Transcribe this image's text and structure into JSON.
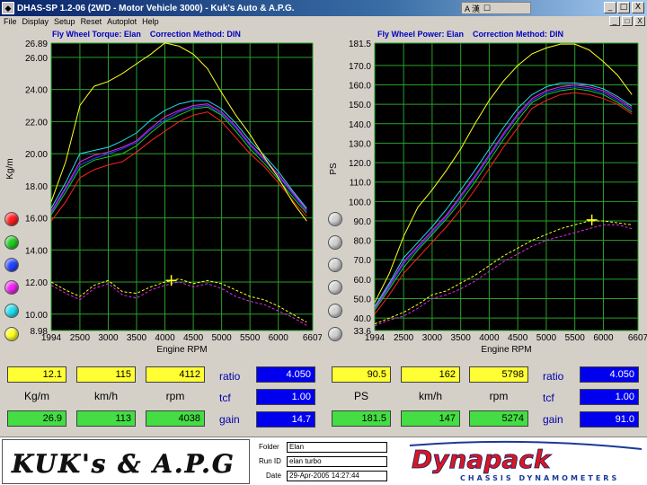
{
  "window": {
    "title": "DHAS-SP 1.2-06  (2WD - Motor Vehicle 3000) - Kuk's Auto & A.P.G.",
    "ime": "A 漢",
    "controls": [
      "_",
      "□",
      "X"
    ]
  },
  "menu": {
    "items": [
      "File",
      "Display",
      "Setup",
      "Reset",
      "Autoplot",
      "Help"
    ],
    "right_controls": [
      "_",
      "□",
      "X"
    ]
  },
  "colors": {
    "background": "#000000",
    "grid": "#2aa02a",
    "yellow_box": "#ffff33",
    "green_box": "#44dd44",
    "blue_box": "#0000ee",
    "label_blue": "#0000c0"
  },
  "run_colors": [
    "#ff2020",
    "#22cc22",
    "#2244ff",
    "#ee22ee",
    "#22ddee",
    "#ffff22"
  ],
  "chart_data": [
    {
      "type": "line",
      "title": "Fly Wheel Torque: Elan",
      "correction": "Correction Method: DIN",
      "xlabel": "Engine RPM",
      "ylabel": "Kg/m",
      "xlim": [
        1994,
        6607
      ],
      "ylim": [
        8.98,
        26.89
      ],
      "xticks": [
        "1994",
        "2500",
        "3000",
        "3500",
        "4000",
        "4500",
        "5000",
        "5500",
        "6000",
        "6607"
      ],
      "yticks": [
        "26.89",
        "26.00",
        "24.00",
        "22.00",
        "20.00",
        "18.00",
        "16.00",
        "14.00",
        "12.00",
        "10.00",
        "8.98"
      ],
      "cursor": {
        "x": 4112,
        "y": 12.1
      },
      "x": [
        1994,
        2250,
        2500,
        2750,
        3000,
        3250,
        3500,
        3750,
        4000,
        4250,
        4500,
        4750,
        5000,
        5250,
        5500,
        5750,
        6000,
        6250,
        6500
      ],
      "series": [
        {
          "name": "Run 1",
          "color": "#ff2020",
          "values": [
            15.8,
            17.0,
            18.5,
            19.0,
            19.3,
            19.5,
            20.1,
            20.8,
            21.4,
            22.0,
            22.4,
            22.6,
            22.0,
            21.0,
            20.0,
            19.2,
            18.2,
            17.1,
            16.1
          ]
        },
        {
          "name": "Run 2",
          "color": "#22cc22",
          "values": [
            16.2,
            17.6,
            19.1,
            19.6,
            19.8,
            20.0,
            20.5,
            21.3,
            22.0,
            22.4,
            22.8,
            22.9,
            22.4,
            21.4,
            20.3,
            19.4,
            18.4,
            17.3,
            16.3
          ]
        },
        {
          "name": "Run 3",
          "color": "#2244ff",
          "values": [
            16.3,
            17.8,
            19.3,
            19.7,
            20.0,
            20.3,
            20.7,
            21.5,
            22.1,
            22.6,
            22.9,
            23.0,
            22.5,
            21.6,
            20.5,
            19.6,
            18.6,
            17.5,
            16.4
          ]
        },
        {
          "name": "Run 4",
          "color": "#ee22ee",
          "values": [
            16.4,
            17.9,
            19.5,
            19.9,
            20.1,
            20.4,
            20.8,
            21.6,
            22.3,
            22.7,
            23.0,
            23.1,
            22.6,
            21.7,
            20.6,
            19.7,
            18.7,
            17.6,
            16.5
          ]
        },
        {
          "name": "Run 5",
          "color": "#22ddee",
          "values": [
            16.6,
            18.2,
            20.0,
            20.2,
            20.4,
            20.8,
            21.3,
            22.1,
            22.7,
            23.1,
            23.3,
            23.3,
            22.8,
            21.9,
            20.8,
            19.9,
            18.9,
            17.7,
            16.6
          ]
        },
        {
          "name": "Run 6",
          "color": "#ffff22",
          "values": [
            17.0,
            19.5,
            23.0,
            24.2,
            24.5,
            25.0,
            25.6,
            26.2,
            26.9,
            26.7,
            26.2,
            25.3,
            23.8,
            22.4,
            21.2,
            19.8,
            18.5,
            17.0,
            15.8
          ]
        },
        {
          "name": "Speed 1",
          "color": "#ee22ee",
          "values": [
            11.8,
            11.3,
            10.9,
            11.6,
            11.9,
            11.2,
            11.0,
            11.5,
            11.8,
            12.0,
            11.7,
            11.9,
            11.6,
            11.1,
            10.8,
            10.6,
            10.2,
            9.8,
            9.3
          ]
        },
        {
          "name": "Speed 2",
          "color": "#ffff22",
          "values": [
            12.0,
            11.5,
            11.1,
            11.8,
            12.1,
            11.4,
            11.3,
            11.7,
            12.0,
            12.2,
            11.9,
            12.1,
            11.9,
            11.5,
            11.1,
            10.9,
            10.5,
            10.0,
            9.5
          ]
        }
      ]
    },
    {
      "type": "line",
      "title": "Fly Wheel Power: Elan",
      "correction": "Correction Method: DIN",
      "xlabel": "Engine RPM",
      "ylabel": "PS",
      "xlim": [
        1994,
        6607
      ],
      "ylim": [
        33.6,
        181.5
      ],
      "xticks": [
        "1994",
        "2500",
        "3000",
        "3500",
        "4000",
        "4500",
        "5000",
        "5500",
        "6000",
        "6607"
      ],
      "yticks": [
        "181.5",
        "170.0",
        "160.0",
        "150.0",
        "140.0",
        "130.0",
        "120.0",
        "110.0",
        "100.0",
        "90.0",
        "80.0",
        "70.0",
        "60.0",
        "50.0",
        "40.0",
        "33.6"
      ],
      "cursor": {
        "x": 5798,
        "y": 90.5
      },
      "x": [
        1994,
        2250,
        2500,
        2750,
        3000,
        3250,
        3500,
        3750,
        4000,
        4250,
        4500,
        4750,
        5000,
        5250,
        5500,
        5750,
        6000,
        6250,
        6500
      ],
      "series": [
        {
          "name": "Run 1",
          "color": "#ff2020",
          "values": [
            42,
            52,
            63,
            71,
            79,
            87,
            96,
            106,
            117,
            128,
            138,
            148,
            152,
            155,
            156,
            155,
            153,
            150,
            145
          ]
        },
        {
          "name": "Run 2",
          "color": "#22cc22",
          "values": [
            44,
            55,
            66,
            75,
            83,
            91,
            100,
            110,
            121,
            132,
            142,
            151,
            155,
            157,
            158,
            157,
            155,
            151,
            146
          ]
        },
        {
          "name": "Run 3",
          "color": "#2244ff",
          "values": [
            45,
            56,
            68,
            76,
            84,
            92,
            102,
            112,
            123,
            134,
            144,
            152,
            156,
            158,
            159,
            158,
            156,
            152,
            147
          ]
        },
        {
          "name": "Run 4",
          "color": "#ee22ee",
          "values": [
            45,
            57,
            69,
            77,
            85,
            93,
            103,
            113,
            124,
            135,
            145,
            153,
            157,
            159,
            160,
            159,
            157,
            153,
            148
          ]
        },
        {
          "name": "Run 5",
          "color": "#22ddee",
          "values": [
            46,
            58,
            71,
            79,
            87,
            96,
            106,
            116,
            127,
            138,
            148,
            155,
            159,
            161,
            161,
            160,
            158,
            154,
            149
          ]
        },
        {
          "name": "Run 6",
          "color": "#ffff22",
          "values": [
            48,
            63,
            82,
            97,
            106,
            116,
            127,
            140,
            152,
            162,
            170,
            176,
            179,
            181,
            181,
            178,
            172,
            165,
            155
          ]
        },
        {
          "name": "Speed 1",
          "color": "#ee22ee",
          "values": [
            36,
            39,
            41,
            45,
            50,
            52,
            55,
            59,
            64,
            69,
            73,
            77,
            80,
            82,
            84,
            86,
            88,
            88,
            86
          ]
        },
        {
          "name": "Speed 2",
          "color": "#ffff22",
          "values": [
            37,
            40,
            43,
            47,
            52,
            54,
            58,
            62,
            67,
            72,
            76,
            80,
            83,
            86,
            88,
            90,
            90,
            89,
            88
          ]
        }
      ]
    }
  ],
  "left_panel": {
    "top": [
      "12.1",
      "115",
      "4112"
    ],
    "units": [
      "Kg/m",
      "km/h",
      "rpm"
    ],
    "bottom": [
      "26.9",
      "113",
      "4038"
    ],
    "tags": [
      "ratio",
      "tcf",
      "gain"
    ],
    "blue": [
      "4.050",
      "1.00",
      "14.7"
    ]
  },
  "right_panel": {
    "top": [
      "90.5",
      "162",
      "5798"
    ],
    "units": [
      "PS",
      "km/h",
      "rpm"
    ],
    "bottom": [
      "181.5",
      "147",
      "5274"
    ],
    "tags": [
      "ratio",
      "tcf",
      "gain"
    ],
    "blue": [
      "4.050",
      "1.00",
      "91.0"
    ]
  },
  "footer": {
    "logo_text": "KUK's & A.P.G",
    "labels": [
      "Folder",
      "Run ID",
      "Date"
    ],
    "values": [
      "Elan",
      "elan turbo",
      "29-Apr-2005  14:27:44"
    ],
    "brand": "Dynapack",
    "brand_sub": "CHASSIS DYNAMOMETERS"
  }
}
